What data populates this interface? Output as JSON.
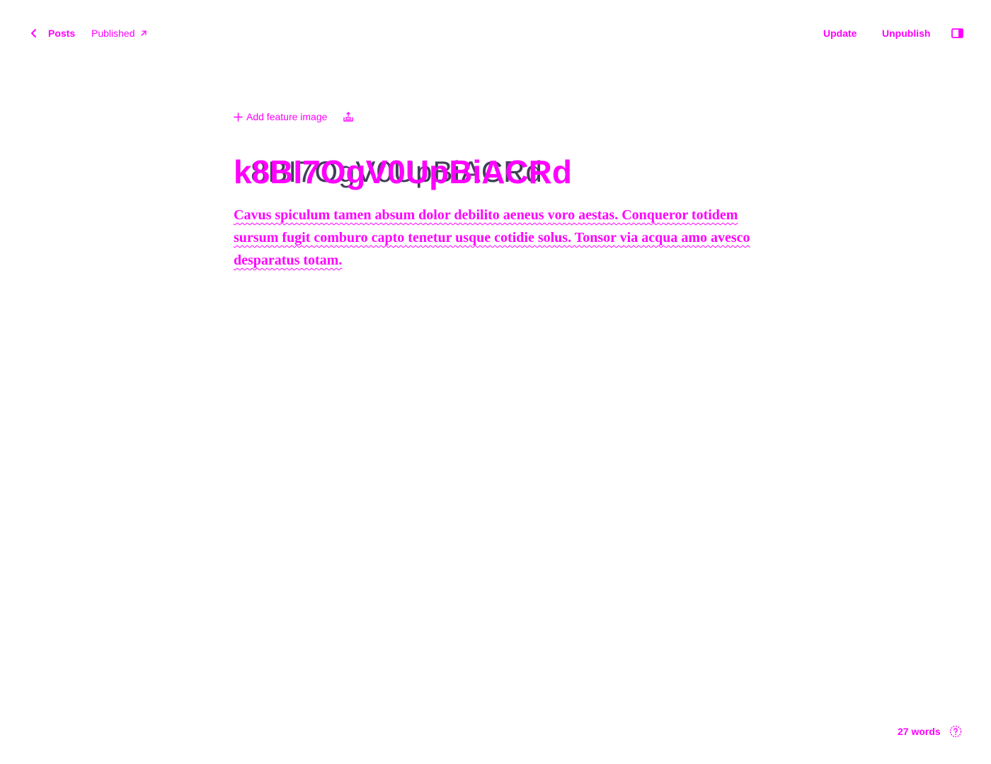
{
  "header": {
    "back_label": "Posts",
    "status_label": "Published",
    "update_label": "Update",
    "unpublish_label": "Unpublish"
  },
  "editor": {
    "add_feature_image_label": "Add feature image",
    "title": "k8BI7OgV0UpBiACRd",
    "body": "Cavus spiculum tamen absum dolor debilito aeneus voro aestas. Conqueror totidem sursum fugit comburo capto tenetur usque cotidie solus. Tonsor via acqua amo avesco desparatus totam."
  },
  "footer": {
    "word_count": "27 words"
  },
  "colors": {
    "accent": "#ff00ff",
    "title_ghost": "#1f1f3a",
    "background": "#ffffff"
  },
  "icons": {
    "back": "chevron-left-icon",
    "external": "arrow-up-right-icon",
    "sidebar": "sidebar-toggle-icon",
    "add": "plus-icon",
    "snippet": "snippet-icon",
    "help": "question-circle-icon"
  }
}
